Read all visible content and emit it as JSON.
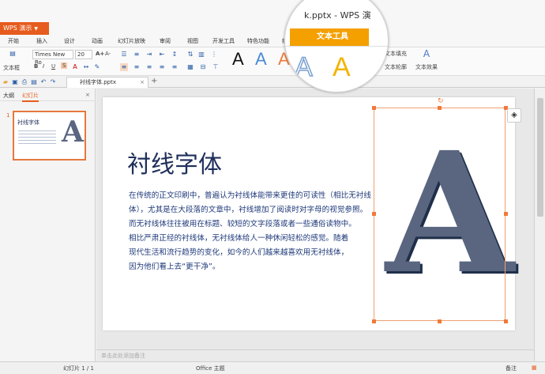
{
  "app": {
    "button_label": "WPS 演示",
    "title_partial": "k.pptx - WPS 演"
  },
  "menu": {
    "tabs": [
      "开始",
      "插入",
      "设计",
      "动画",
      "幻灯片放映",
      "审阅",
      "视图",
      "开发工具",
      "特色功能",
      "绘"
    ]
  },
  "ribbon": {
    "textbox_label": "文本框",
    "font_name": "Times New Ro",
    "font_size": "20",
    "grow_font": "A+",
    "shrink_font": "A-",
    "bold": "B",
    "italic": "I",
    "underline": "U",
    "shadow": "S",
    "text_fill": "文本填充",
    "text_outline": "文本轮廓",
    "text_effects": "文本效果",
    "style_letters": [
      "A",
      "A",
      "A"
    ]
  },
  "magnifier": {
    "title": "k.pptx - WPS 演",
    "tab_label": "文本工具",
    "style_letters": [
      "A",
      "A"
    ]
  },
  "quickbar": {
    "doc_tab": "衬线字体.pptx",
    "close": "×",
    "new_tab": "+"
  },
  "left_panel": {
    "tab_outline": "大纲",
    "tab_slides": "幻灯片",
    "slide_number": "1",
    "thumb_title": "衬线字体"
  },
  "slide": {
    "title": "衬线字体",
    "body_lines": [
      "在传统的正文印刷中，普遍认为衬线体能带来更佳的可读性（相比无衬线",
      "体），尤其是在大段落的文章中，衬线增加了阅读时对字母的视觉参照。",
      "而无衬线体往往被用在标题、较短的文字段落或者一些通俗读物中。",
      "相比严肃正经的衬线体，无衬线体给人一种休闲轻松的感觉。随着",
      "现代生活和流行趋势的变化，如今的人们越来越喜欢用无衬线体，",
      "因为他们看上去“更干净”。"
    ],
    "big_letter": "A"
  },
  "notes_placeholder": "单击此处添加备注",
  "status": {
    "slide_counter": "幻灯片 1 / 1",
    "theme": "Office 主题",
    "notes_label": "备注"
  },
  "colors": {
    "accent": "#e65c1e",
    "text_tool_tab": "#f4a000",
    "title_text": "#1f2f5a",
    "body_text": "#1f3a7a"
  }
}
